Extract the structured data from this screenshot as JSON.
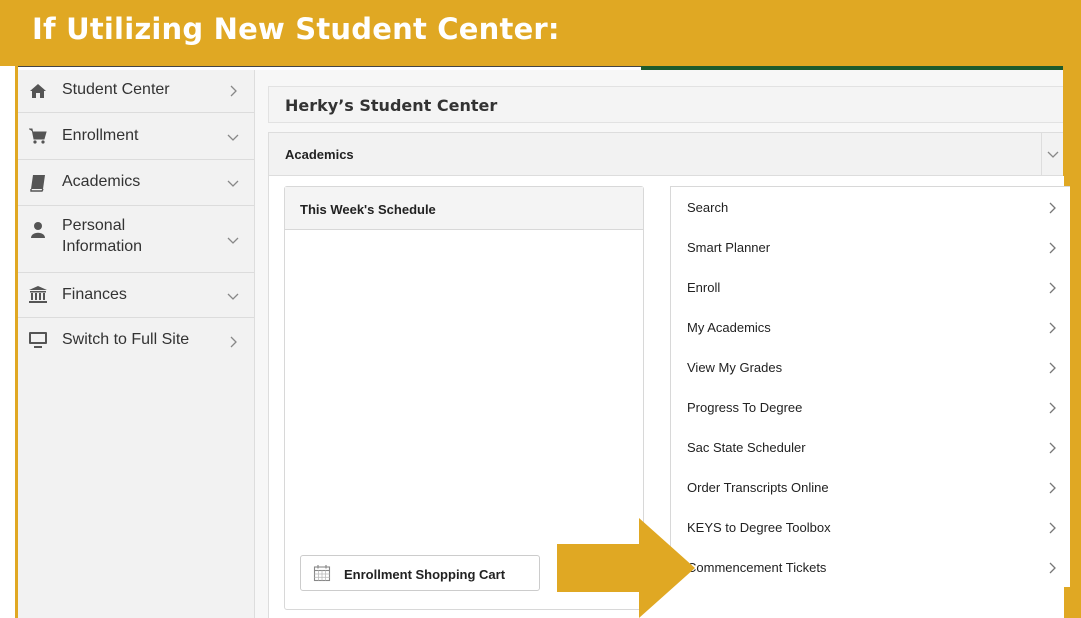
{
  "banner": {
    "title": "If Utilizing New Student Center:"
  },
  "sidebar": {
    "items": [
      {
        "label": "Student Center",
        "icon": "home-icon",
        "chevron": "right"
      },
      {
        "label": "Enrollment",
        "icon": "cart-icon",
        "chevron": "down"
      },
      {
        "label": "Academics",
        "icon": "book-icon",
        "chevron": "down"
      },
      {
        "label_line1": "Personal",
        "label_line2": "Information",
        "icon": "person-icon",
        "chevron": "down"
      },
      {
        "label": "Finances",
        "icon": "bank-icon",
        "chevron": "down"
      },
      {
        "label": "Switch to Full Site",
        "icon": "monitor-icon",
        "chevron": "right"
      }
    ]
  },
  "main": {
    "title": "Herky’s Student Center",
    "section_title": "Academics",
    "schedule": {
      "title": "This Week's Schedule",
      "cart_button": "Enrollment Shopping Cart"
    },
    "links": [
      "Search",
      "Smart Planner",
      "Enroll",
      "My Academics",
      "View My Grades",
      "Progress To Degree",
      "Sac State Scheduler",
      "Order Transcripts Online",
      "KEYS to Degree Toolbox",
      "Commencement Tickets"
    ]
  },
  "colors": {
    "banner": "#e0a823",
    "accent_green": "#1e5b2c",
    "arrow": "#e0a823"
  }
}
